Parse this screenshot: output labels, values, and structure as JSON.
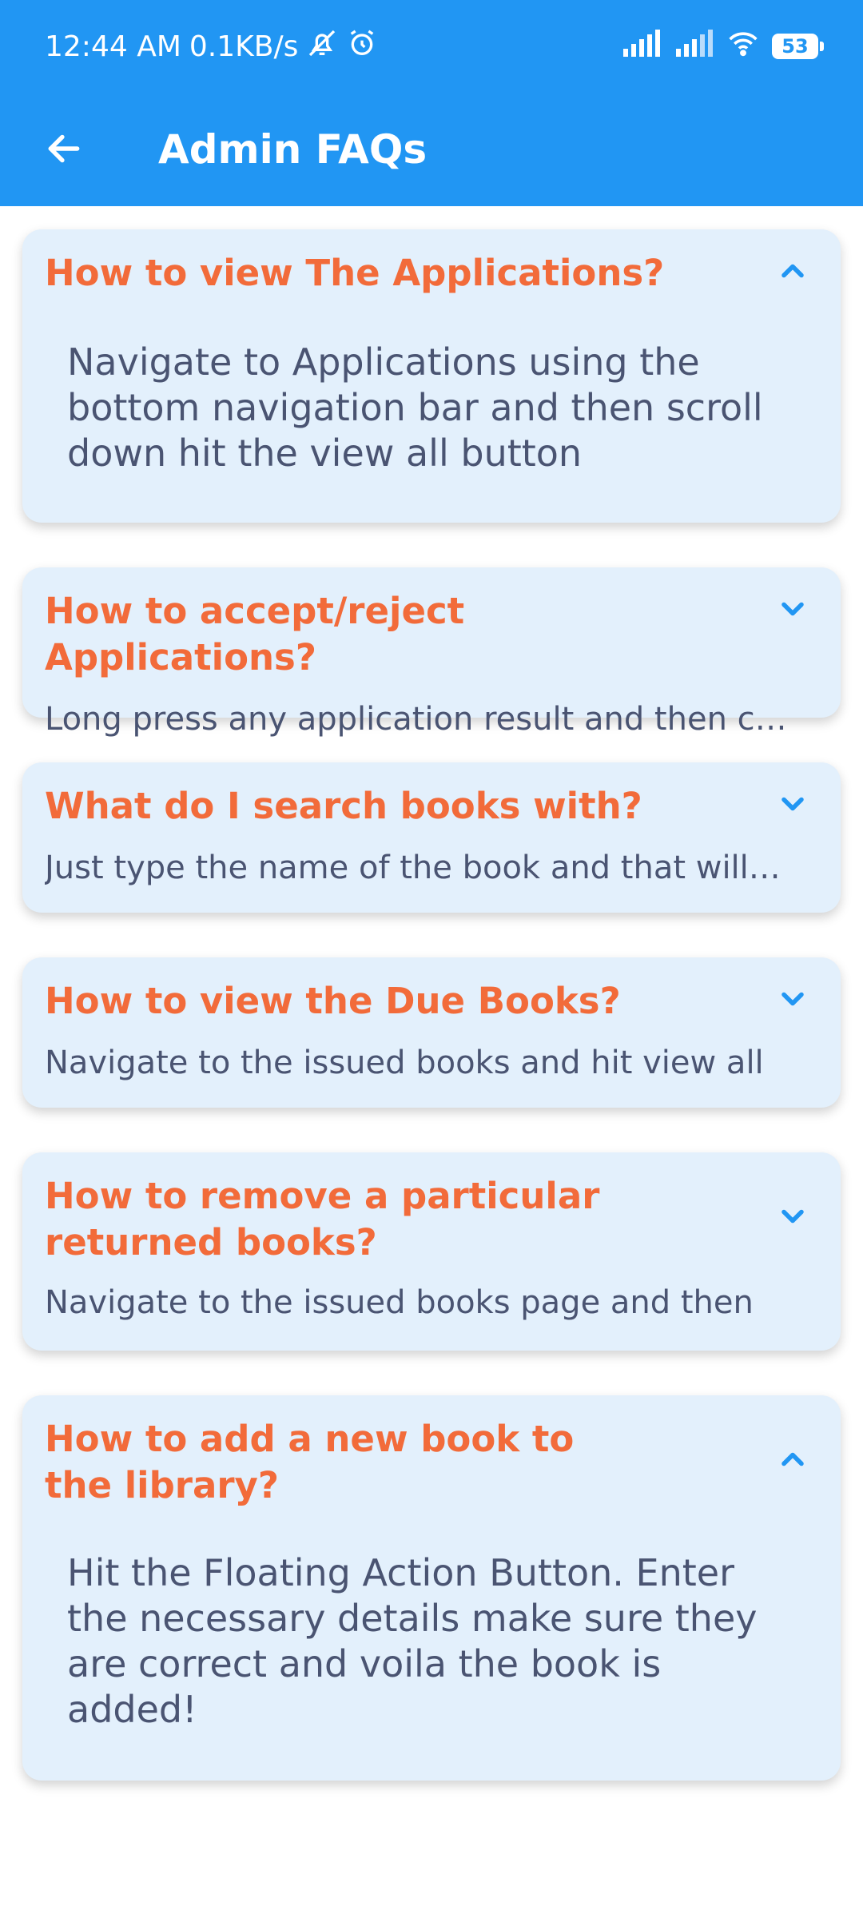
{
  "status_bar": {
    "time": "12:44 AM",
    "speed": "0.1KB/s",
    "battery": "53"
  },
  "app_bar": {
    "title": "Admin FAQs"
  },
  "faqs": [
    {
      "question": "How to view The Applications?",
      "answer": "Navigate to Applications using the bottom navigation bar and then scroll down hit the view all button",
      "expanded": true
    },
    {
      "question": "How to accept/reject Applications?",
      "answer": "Long press any application result and then choose accept or reject",
      "expanded": false
    },
    {
      "question": "What do I search books with?",
      "answer": "Just type the name of the book and that will do",
      "expanded": false
    },
    {
      "question": "How to view the Due Books?",
      "answer": "Navigate to the issued books and hit view all",
      "expanded": false
    },
    {
      "question": "How to remove a particular returned books?",
      "answer": "Navigate to the issued books page and then",
      "expanded": false
    },
    {
      "question": "How to add a new book to the library?",
      "answer": "Hit the Floating Action Button. Enter the necessary details make sure they are correct and voila the book is added!",
      "expanded": true
    }
  ]
}
